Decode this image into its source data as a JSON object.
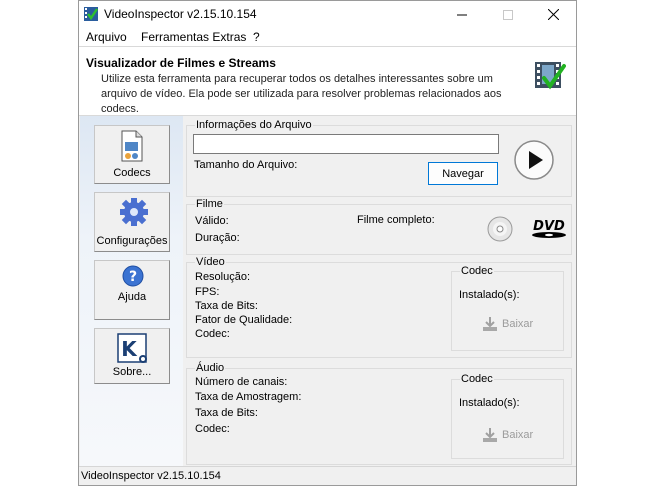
{
  "window": {
    "title": "VideoInspector v2.15.10.154",
    "status": "VideoInspector v2.15.10.154"
  },
  "menu": [
    "Arquivo",
    "Ferramentas Extras",
    "?"
  ],
  "banner": {
    "title": "Visualizador de Filmes e Streams",
    "description": "Utilize esta ferramenta para recuperar todos os detalhes interessantes sobre um arquivo de vídeo. Ela pode ser utilizada para resolver problemas relacionados aos codecs."
  },
  "sidebar": {
    "codecs": "Codecs",
    "configuracoes": "Configurações",
    "ajuda": "Ajuda",
    "sobre": "Sobre..."
  },
  "file_info": {
    "title": "Informações do Arquivo",
    "path_value": "",
    "size_label": "Tamanho do Arquivo:",
    "browse_label": "Navegar"
  },
  "film": {
    "title": "Filme",
    "valid_label": "Válido:",
    "duration_label": "Duração:",
    "complete_label": "Filme completo:",
    "dvd_text": "DVD"
  },
  "video": {
    "title": "Vídeo",
    "resolution_label": "Resolução:",
    "fps_label": "FPS:",
    "bitrate_label": "Taxa de Bits:",
    "quality_label": "Fator de Qualidade:",
    "codec_label": "Codec:",
    "codec_group": {
      "title": "Codec",
      "installed_label": "Instalado(s):",
      "download_label": "Baixar"
    }
  },
  "audio": {
    "title": "Áudio",
    "channels_label": "Número de canais:",
    "samplerate_label": "Taxa de Amostragem:",
    "bitrate_label": "Taxa de Bits:",
    "codec_label": "Codec:",
    "codec_group": {
      "title": "Codec",
      "installed_label": "Instalado(s):",
      "download_label": "Baixar"
    }
  }
}
